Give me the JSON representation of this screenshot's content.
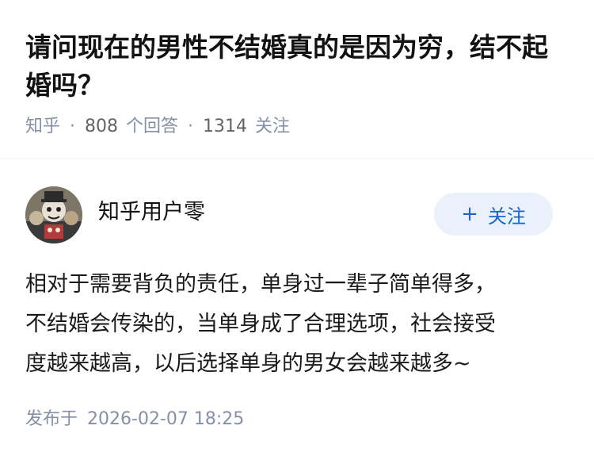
{
  "question": {
    "title": "请问现在的男性不结婚真的是因为穷，结不起婚吗？",
    "source": "知乎",
    "answer_count": "808",
    "answer_unit": "个回答",
    "follower_count": "1314",
    "follower_unit": "关注"
  },
  "answer": {
    "author_name": "知乎用户零",
    "follow_label": "关注",
    "follow_icon": "plus-icon",
    "paragraphs": [
      "相对于需要背负的责任，单身过一辈子简单得多，",
      "不结婚会传染的，当单身成了合理选项，社会接受",
      "度越来越高，以后选择单身的男女会越来越多~"
    ],
    "published_label": "发布于",
    "published_time": "2026-02-07 18:25"
  },
  "colors": {
    "title": "#121212",
    "meta": "#8590a6",
    "follow_bg": "#ebf1fb",
    "follow_text": "#1a65c9"
  }
}
